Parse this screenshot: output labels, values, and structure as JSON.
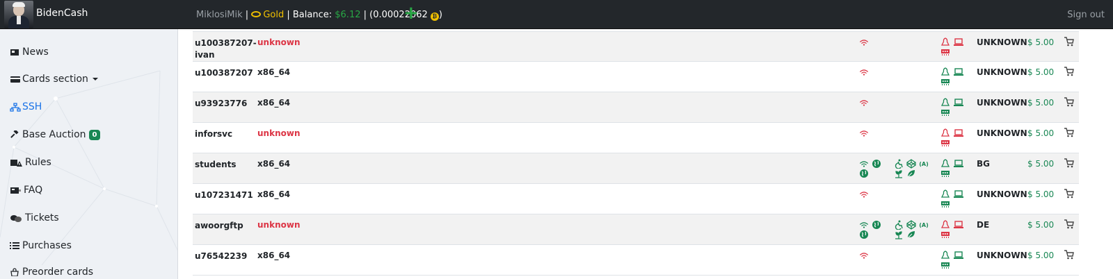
{
  "header": {
    "brand": "BidenCash",
    "username": "MiklosiMik",
    "sep1": " | ",
    "level": "Gold",
    "sep2": " | ",
    "balance_label": "Balance: ",
    "balance_value": "$6.12",
    "sep3": " | ",
    "crypto_open": "(0.00022062 ",
    "crypto_close": ")",
    "coin_icon": "bitcoin-coin-icon",
    "add_funds_icon": "plus-icon",
    "signout": "Sign out"
  },
  "sidebar": {
    "items": [
      {
        "label": "News",
        "icon": "newspaper-icon"
      },
      {
        "label": "Cards section",
        "icon": "credit-card-icon"
      },
      {
        "label": "SSH",
        "icon": "network-icon"
      },
      {
        "label": "Base Auction",
        "icon": "gavel-icon",
        "badge": "0"
      },
      {
        "label": "Rules",
        "icon": "rules-icon"
      },
      {
        "label": "FAQ",
        "icon": "faq-icon"
      },
      {
        "label": "Tickets",
        "icon": "tickets-icon"
      },
      {
        "label": "Purchases",
        "icon": "list-icon"
      },
      {
        "label": "Preorder cards",
        "icon": "bag-icon"
      }
    ]
  },
  "colors": {
    "red": "#dc3545",
    "green": "#198754",
    "gold": "#f0c000",
    "navbar": "#23272b"
  },
  "table": {
    "rows": [
      {
        "name": "u100387207-ivan",
        "arch": "unknown",
        "country": "UNKNOWN",
        "price": "$ 5.00",
        "net_ok": false,
        "os_ok": false,
        "extras": false
      },
      {
        "name": "u100387207",
        "arch": "x86_64",
        "country": "UNKNOWN",
        "price": "$ 5.00",
        "net_ok": false,
        "os_ok": true,
        "extras": false
      },
      {
        "name": "u93923776",
        "arch": "x86_64",
        "country": "UNKNOWN",
        "price": "$ 5.00",
        "net_ok": false,
        "os_ok": true,
        "extras": false
      },
      {
        "name": "inforsvc",
        "arch": "unknown",
        "country": "UNKNOWN",
        "price": "$ 5.00",
        "net_ok": false,
        "os_ok": false,
        "extras": false
      },
      {
        "name": "students",
        "arch": "x86_64",
        "country": "BG",
        "price": "$ 5.00",
        "net_ok": true,
        "os_ok": true,
        "extras": true
      },
      {
        "name": "u107231471",
        "arch": "x86_64",
        "country": "UNKNOWN",
        "price": "$ 5.00",
        "net_ok": false,
        "os_ok": true,
        "extras": false
      },
      {
        "name": "awoorgftp",
        "arch": "unknown",
        "country": "DE",
        "price": "$ 5.00",
        "net_ok": true,
        "os_ok": false,
        "extras": true
      },
      {
        "name": "u76542239",
        "arch": "x86_64",
        "country": "UNKNOWN",
        "price": "$ 5.00",
        "net_ok": false,
        "os_ok": true,
        "extras": false
      }
    ]
  }
}
